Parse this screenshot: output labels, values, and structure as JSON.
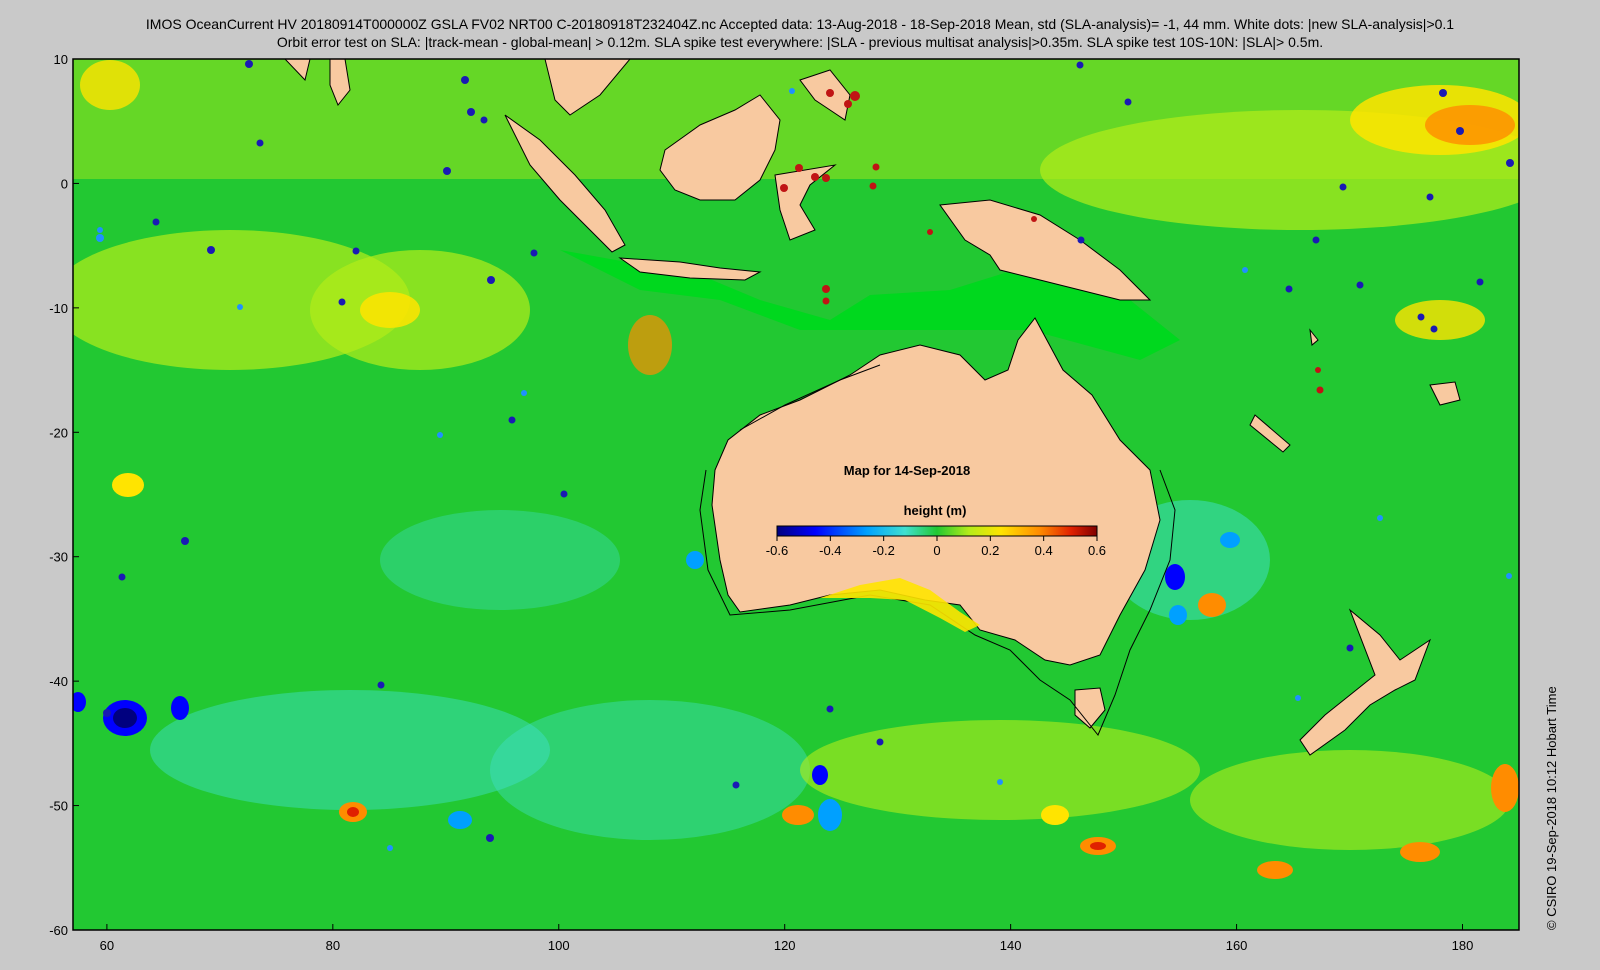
{
  "header": {
    "line1": "IMOS OceanCurrent HV 20180914T000000Z GSLA FV02 NRT00 C-20180918T232404Z.nc  Accepted data: 13-Aug-2018 - 18-Sep-2018 Mean, std (SLA-analysis)= -1, 44 mm. White dots: |new SLA-analysis|>0.1",
    "line2": "Orbit error test on SLA: |track-mean  - global-mean| > 0.12m.  SLA spike test everywhere: |SLA - previous multisat analysis|>0.35m. SLA spike test 10S-10N: |SLA|> 0.5m."
  },
  "map": {
    "caption": "Map for 14-Sep-2018",
    "lon_range": [
      57,
      185
    ],
    "lat_range": [
      -60,
      10
    ],
    "x_ticks": [
      "60",
      "80",
      "100",
      "120",
      "140",
      "160",
      "180"
    ],
    "y_ticks": [
      "10",
      "0",
      "-10",
      "-20",
      "-30",
      "-40",
      "-50",
      "-60"
    ],
    "colors": {
      "land": "#f8c9a0",
      "ocean_base": "#22c832",
      "frame": "#000000"
    }
  },
  "colorbar": {
    "title": "height (m)",
    "tick_labels": [
      "-0.6",
      "-0.4",
      "-0.2",
      "0",
      "0.2",
      "0.4",
      "0.6"
    ],
    "range": [
      -0.6,
      0.6
    ],
    "colors": [
      "#00007f",
      "#0000ff",
      "#00a0ff",
      "#40e0d0",
      "#22c832",
      "#b4ec1a",
      "#ffe400",
      "#ff8c00",
      "#e02000",
      "#7f0000"
    ]
  },
  "credit": "©  CSIRO 19-Sep-2018 10:12 Hobart Time"
}
